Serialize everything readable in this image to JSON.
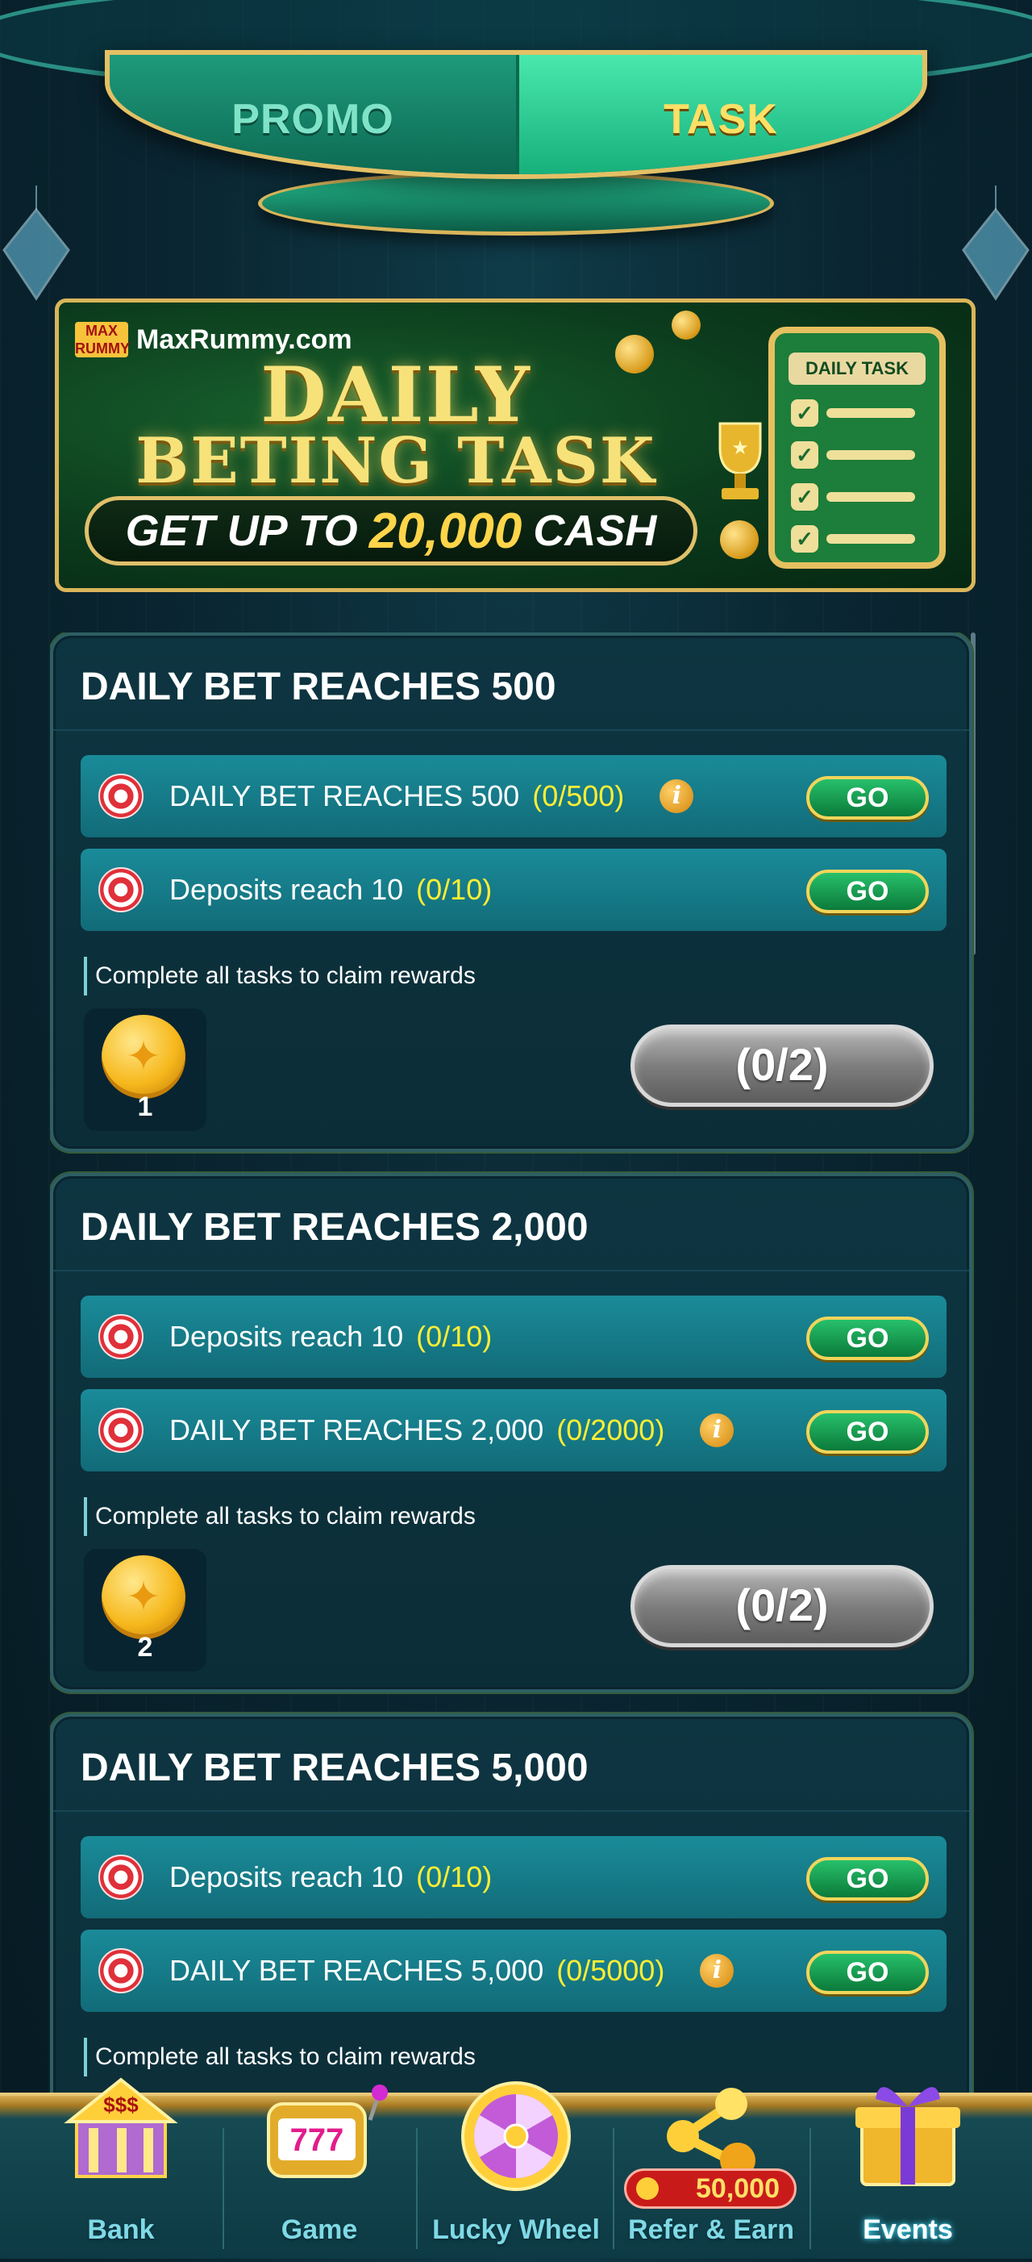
{
  "tabs": {
    "promo": "PROMO",
    "task": "TASK",
    "active": "task"
  },
  "banner": {
    "brand_logo": "MAX RUMMY",
    "brand": "MaxRummy.com",
    "title_line1": "DAILY",
    "title_line2": "BETING TASK",
    "cta_prefix": "GET UP TO",
    "cta_amount": "20,000",
    "cta_suffix": "CASH",
    "board_title": "DAILY TASK"
  },
  "cards": [
    {
      "title": "DAILY BET REACHES 500",
      "tasks": [
        {
          "text": "DAILY BET REACHES 500",
          "progress": "(0/500)",
          "info": true,
          "button": "GO"
        },
        {
          "text": "Deposits reach 10",
          "progress": "(0/10)",
          "info": false,
          "button": "GO"
        }
      ],
      "note": "Complete all tasks to claim rewards",
      "reward_qty": "1",
      "claim_status": "(0/2)"
    },
    {
      "title": "DAILY BET REACHES 2,000",
      "tasks": [
        {
          "text": "Deposits reach 10",
          "progress": "(0/10)",
          "info": false,
          "button": "GO"
        },
        {
          "text": "DAILY BET REACHES 2,000",
          "progress": "(0/2000)",
          "info": true,
          "button": "GO"
        }
      ],
      "note": "Complete all tasks to claim rewards",
      "reward_qty": "2",
      "claim_status": "(0/2)"
    },
    {
      "title": "DAILY BET REACHES 5,000",
      "tasks": [
        {
          "text": "Deposits reach 10",
          "progress": "(0/10)",
          "info": false,
          "button": "GO"
        },
        {
          "text": "DAILY BET REACHES 5,000",
          "progress": "(0/5000)",
          "info": true,
          "button": "GO"
        }
      ],
      "note": "Complete all tasks to claim rewards"
    }
  ],
  "nav": {
    "bank": "Bank",
    "game": "Game",
    "slot_reels": "777",
    "lucky_wheel": "Lucky Wheel",
    "refer_earn": "Refer & Earn",
    "refer_badge": "50,000",
    "events": "Events",
    "active": "events"
  },
  "colors": {
    "progress_text": "#ffee33",
    "go_button": "#1a9a52",
    "accent_gold": "#d9b55a"
  }
}
